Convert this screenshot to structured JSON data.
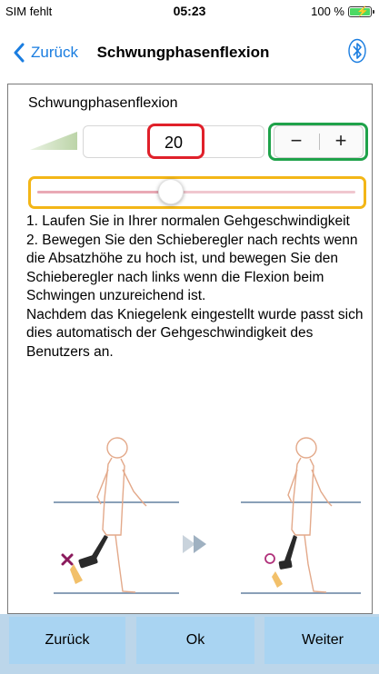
{
  "status_bar": {
    "carrier": "SIM fehlt",
    "time": "05:23",
    "battery": "100 %"
  },
  "nav": {
    "back_label": "Zurück",
    "title": "Schwungphasenflexion",
    "bluetooth_icon": "bluetooth-icon"
  },
  "setting": {
    "label": "Schwungphasenflexion",
    "value": "20",
    "decrement_label": "−",
    "increment_label": "+",
    "slider_level": 0.42
  },
  "instructions": [
    "1. Laufen Sie in Ihrer normalen Gehgeschwindigkeit",
    "2. Bewegen Sie den Schieberegler nach rechts wenn die Absatzhöhe zu hoch ist, und bewegen Sie den Schieberegler nach links wenn die Flexion beim  Schwingen unzureichend ist.",
    "Nachdem das Kniegelenk eingestellt wurde passt sich dies automatisch der Gehgeschwindigkeit des Benutzers an."
  ],
  "footer": {
    "back_label": "Zurück",
    "ok_label": "Ok",
    "next_label": "Weiter"
  },
  "colors": {
    "accent": "#1a7de0",
    "highlight_value": "#e0202a",
    "highlight_stepper": "#1fa24a",
    "highlight_slider": "#f3b617",
    "footer_button": "#a9d4f2",
    "footer_bar": "#bcd6ea"
  }
}
